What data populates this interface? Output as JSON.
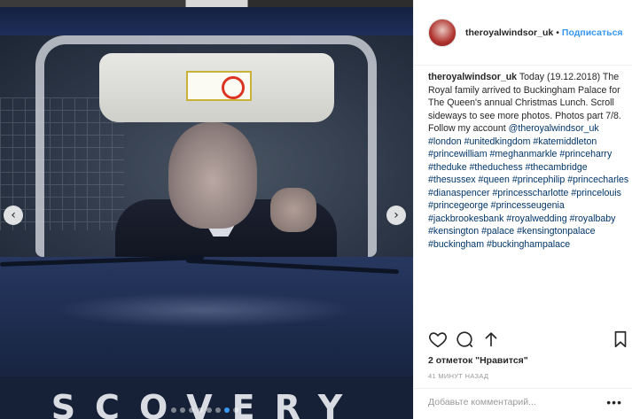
{
  "post": {
    "username": "theroyalwindsor_uk",
    "separator": "•",
    "follow_label": "Подписаться",
    "caption_user": "theroyalwindsor_uk",
    "caption_text": " Today (19.12.2018) The Royal family arrived to Buckingham Palace for The Queen's annual Christmas Lunch. Scroll sideways to see more photos. Photos part 7/8. Follow my account ",
    "caption_mention": "@theroyalwindsor_uk",
    "caption_tags": " #london #unitedkingdom #katemiddleton #princewilliam #meghanmarkle #princeharry #theduke #theduchess #thecambridge #thesussex #queen #princephilip #princecharles #dianaspencer #princesscharlotte #princelouis #princegeorge #princesseugenia #jackbrookesbank #royalwedding #royalbaby #kensington #palace #kensingtonpalace #buckingham #buckinghampalace",
    "likes_text": "2 отметок \"Нравится\"",
    "time_text": "41 МИНУТ НАЗАД",
    "comment_placeholder": "Добавьте комментарий...",
    "more_label": "•••"
  },
  "media": {
    "brand_text": "SCOVERY",
    "carousel_count": 8,
    "carousel_active_index": 6
  },
  "icons": {
    "like": "heart-icon",
    "comment": "comment-icon",
    "share": "share-icon",
    "save": "bookmark-icon",
    "prev": "chevron-left-icon",
    "next": "chevron-right-icon"
  },
  "colors": {
    "link": "#3897f0",
    "hashtag": "#003569",
    "text": "#262626",
    "muted": "#999999"
  }
}
